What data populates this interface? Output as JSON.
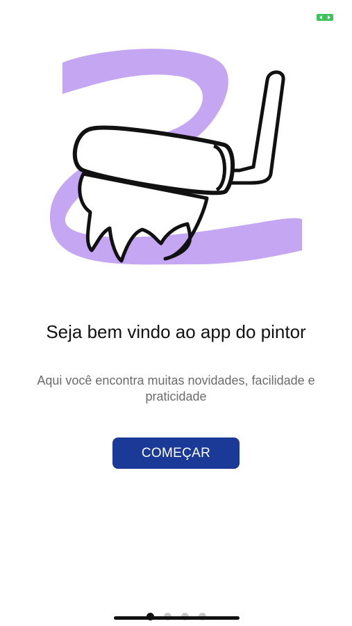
{
  "status": {
    "indicator_icon": "battery-charging-icon",
    "indicator_color": "#3cc45a"
  },
  "illustration": {
    "name": "paint-roller-illustration",
    "accent_color": "#c4a6f2"
  },
  "welcome": {
    "title": "Seja bem vindo ao app do pintor",
    "subtitle": "Aqui você encontra muitas novidades, facilidade e praticidade"
  },
  "actions": {
    "start_label": "COMEÇAR",
    "button_color": "#1b3a98",
    "button_text_color": "#ffffff"
  },
  "pager": {
    "total": 4,
    "active": 1
  }
}
